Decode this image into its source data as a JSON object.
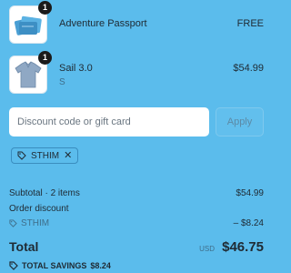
{
  "line_items": [
    {
      "name": "Adventure Passport",
      "variant": "",
      "price": "FREE",
      "quantity": "1",
      "image_icon": "passport-booklets-image"
    },
    {
      "name": "Sail 3.0",
      "variant": "S",
      "price": "$54.99",
      "quantity": "1",
      "image_icon": "polo-shirt-image"
    }
  ],
  "discount": {
    "placeholder": "Discount code or gift card",
    "value": "",
    "apply_label": "Apply",
    "applied_code": "STHIM",
    "remove_icon": "close-icon"
  },
  "summary": {
    "subtotal_label": "Subtotal · 2 items",
    "subtotal_value": "$54.99",
    "order_discount_label": "Order discount",
    "discount_code": "STHIM",
    "discount_value": "– $8.24",
    "total_label": "Total",
    "currency": "USD",
    "total_value": "$46.75",
    "savings_label": "TOTAL SAVINGS",
    "savings_value": "$8.24"
  },
  "colors": {
    "background": "#5bbcec",
    "text": "#1f2a33",
    "muted": "#3f6e8a",
    "badge": "#1a1a1a"
  }
}
